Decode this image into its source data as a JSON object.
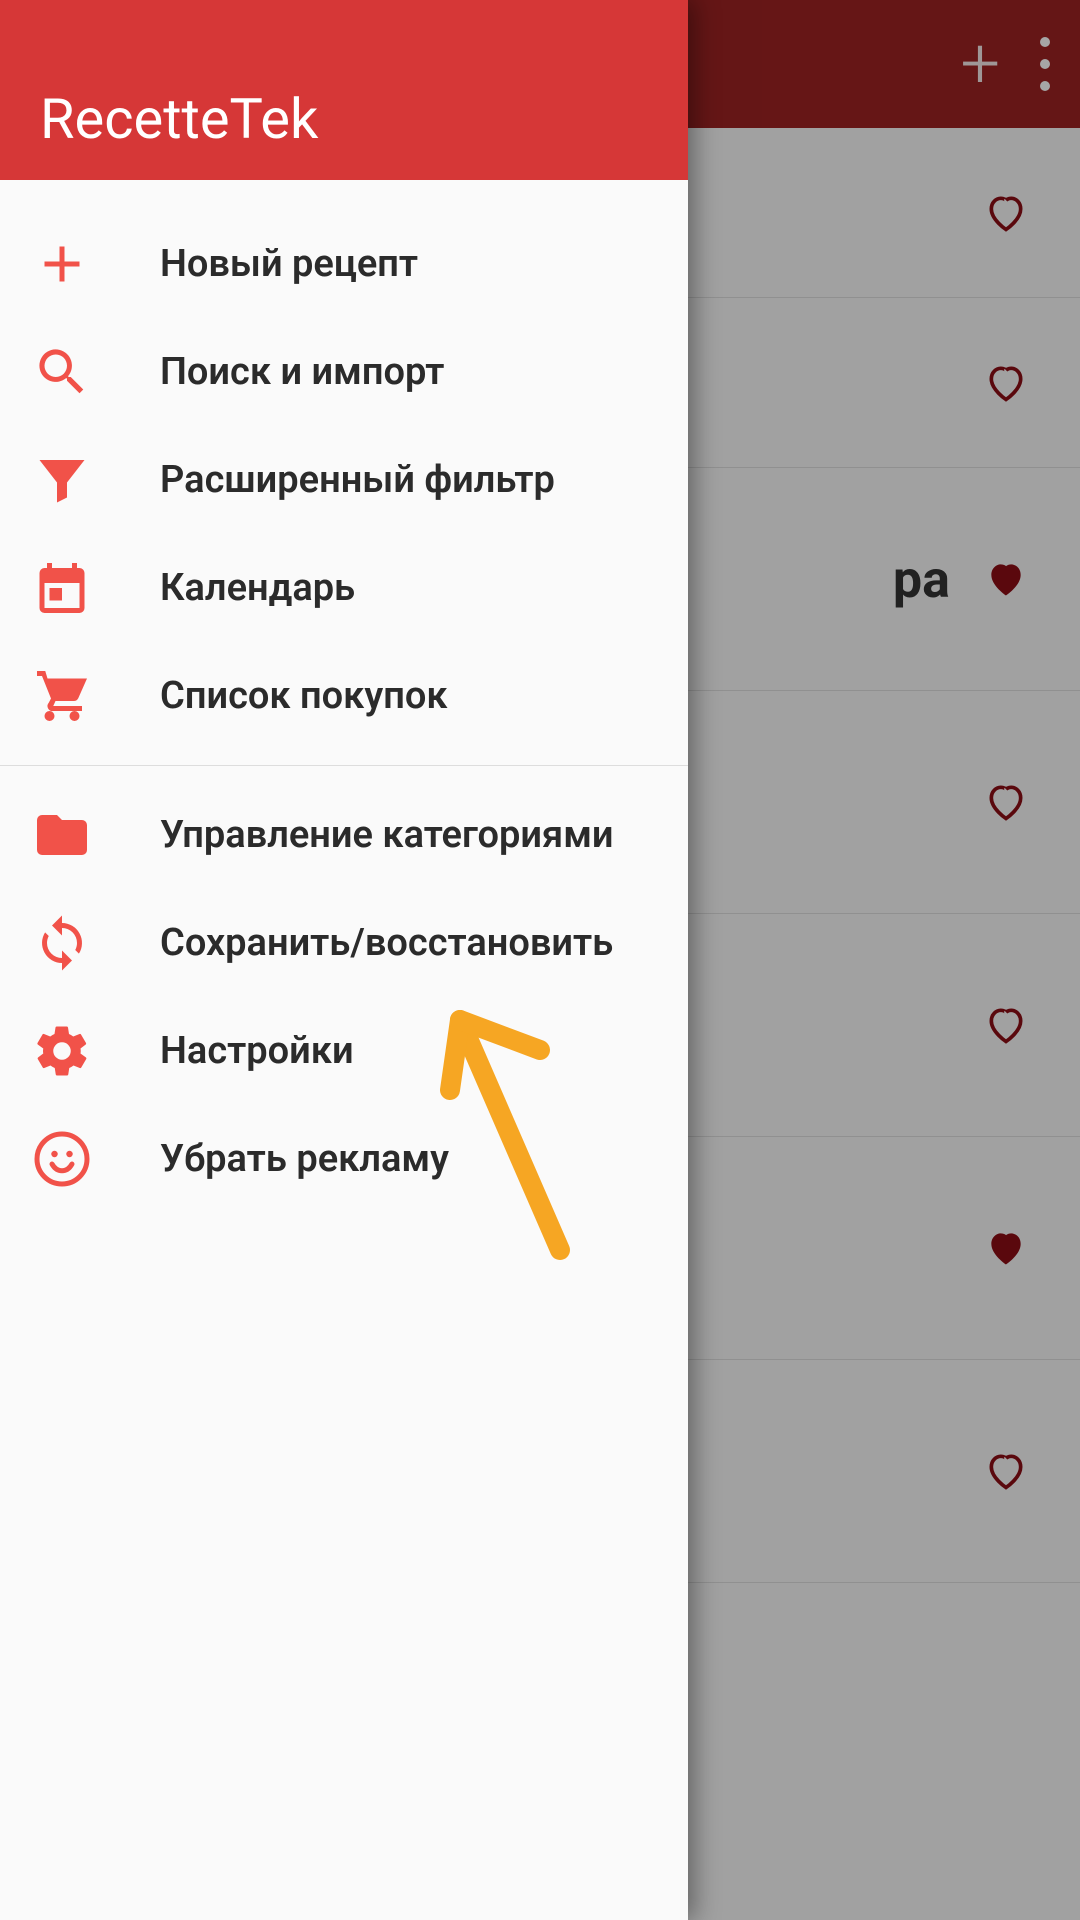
{
  "app": {
    "name": "RecetteTek"
  },
  "colors": {
    "accent": "#F15249",
    "drawerHeader": "#D63737",
    "toolbarDim": "#9c2222",
    "annotation": "#F6A623",
    "favoriteDark": "#8b0d14"
  },
  "background": {
    "visibleTextFragment": "ра",
    "rows": [
      {
        "favorite": false
      },
      {
        "favorite": false
      },
      {
        "favorite": true,
        "textFragment": "ра"
      },
      {
        "favorite": false
      },
      {
        "favorite": false
      },
      {
        "favorite": true
      },
      {
        "favorite": false
      }
    ]
  },
  "drawer": {
    "groups": [
      {
        "items": [
          {
            "icon": "plus-icon",
            "label": "Новый рецепт"
          },
          {
            "icon": "search-icon",
            "label": "Поиск и импорт"
          },
          {
            "icon": "filter-icon",
            "label": "Расширенный фильтр"
          },
          {
            "icon": "calendar-icon",
            "label": "Календарь"
          },
          {
            "icon": "cart-icon",
            "label": "Список покупок"
          }
        ]
      },
      {
        "items": [
          {
            "icon": "folder-icon",
            "label": "Управление категориями"
          },
          {
            "icon": "sync-icon",
            "label": "Сохранить/восстановить"
          },
          {
            "icon": "gear-icon",
            "label": "Настройки"
          },
          {
            "icon": "smile-icon",
            "label": "Убрать рекламу"
          }
        ]
      }
    ]
  }
}
